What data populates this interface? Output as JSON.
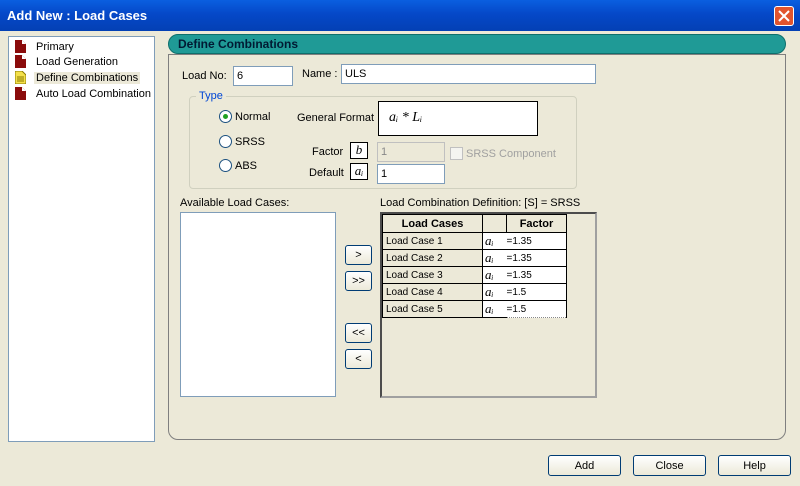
{
  "window": {
    "title": "Add New : Load Cases"
  },
  "nav": {
    "items": [
      {
        "label": "Primary"
      },
      {
        "label": "Load Generation"
      },
      {
        "label": "Define Combinations"
      },
      {
        "label": "Auto Load Combination"
      }
    ]
  },
  "panel": {
    "title": "Define Combinations"
  },
  "form": {
    "load_no_label": "Load No:",
    "load_no_value": "6",
    "name_label": "Name :",
    "name_value": "ULS",
    "type_legend": "Type",
    "radio_normal": "Normal",
    "radio_srss": "SRSS",
    "radio_abs": "ABS",
    "general_format_label": "General Format :",
    "formula": "aᵢ * Lᵢ",
    "factor_label": "Factor",
    "factor_symbol": "b",
    "factor_value": "1",
    "srss_component_label": "SRSS Component",
    "default_label": "Default",
    "default_symbol": "aᵢ",
    "default_value": "1"
  },
  "available": {
    "label": "Available Load Cases:"
  },
  "definition": {
    "label": "Load Combination Definition:  [S] = SRSS",
    "col_cases": "Load Cases",
    "col_factor": "Factor",
    "rows": [
      {
        "name": "Load Case 1",
        "sym": "aᵢ",
        "value": "=1.35"
      },
      {
        "name": "Load Case 2",
        "sym": "aᵢ",
        "value": "=1.35"
      },
      {
        "name": "Load Case 3",
        "sym": "aᵢ",
        "value": "=1.35"
      },
      {
        "name": "Load Case 4",
        "sym": "aᵢ",
        "value": "=1.5"
      },
      {
        "name": "Load Case 5",
        "sym": "aᵢ",
        "value": "=1.5"
      }
    ]
  },
  "transfer": {
    "add_one": ">",
    "add_all": ">>",
    "remove_all": "<<",
    "remove_one": "<"
  },
  "footer": {
    "add": "Add",
    "close": "Close",
    "help": "Help"
  }
}
